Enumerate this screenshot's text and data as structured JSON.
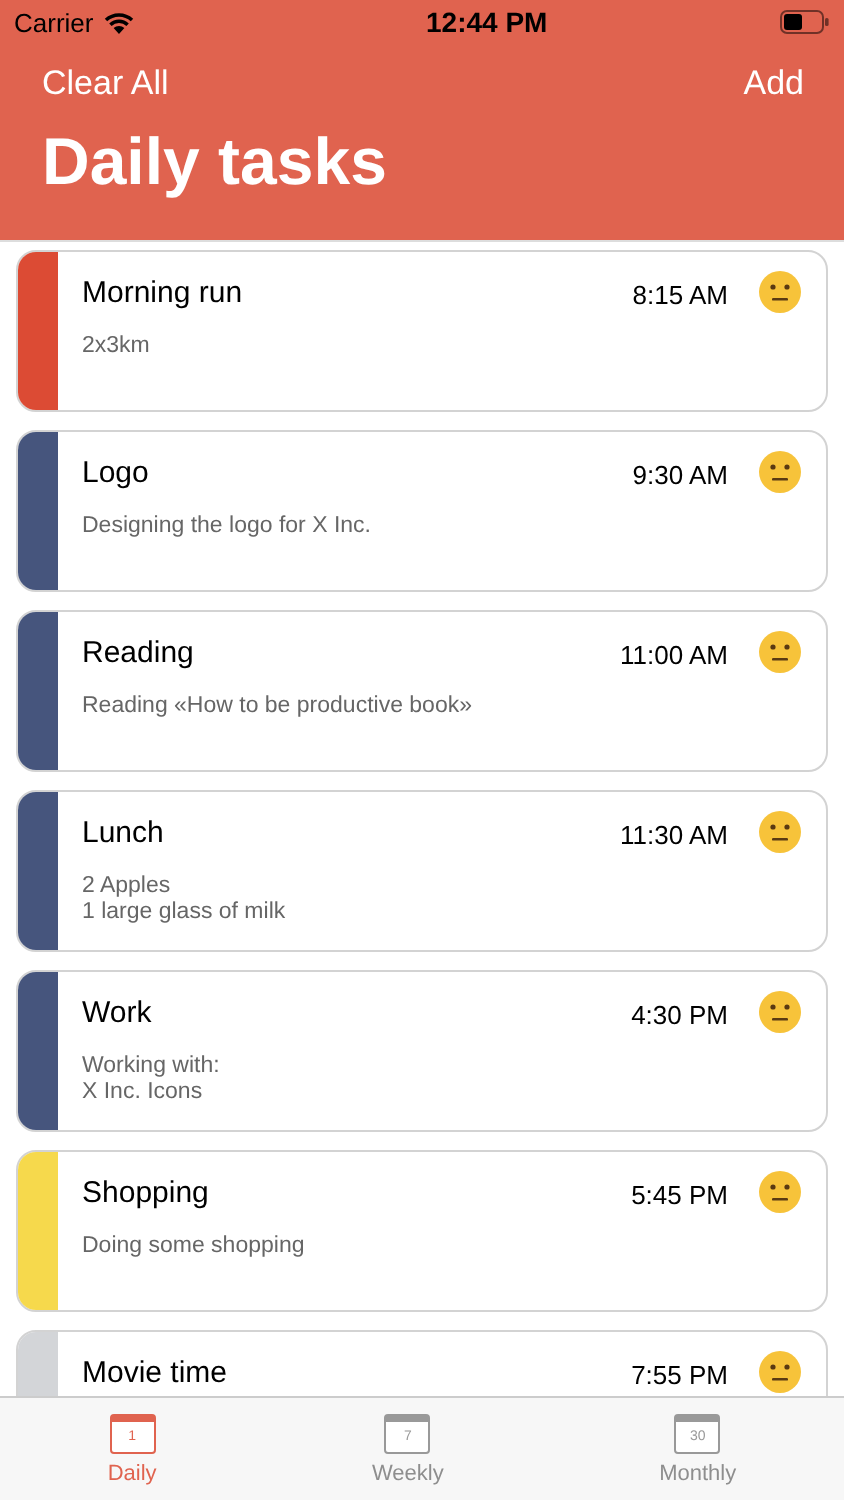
{
  "status_bar": {
    "carrier": "Carrier",
    "time": "12:44 PM"
  },
  "nav": {
    "left": "Clear All",
    "right": "Add",
    "title": "Daily tasks"
  },
  "tasks": [
    {
      "title": "Morning run",
      "time": "8:15 AM",
      "color": "#dc4b34",
      "notes": [
        "2x3km"
      ]
    },
    {
      "title": "Logo",
      "time": "9:30 AM",
      "color": "#46557d",
      "notes": [
        "Designing the logo for X Inc."
      ]
    },
    {
      "title": "Reading",
      "time": "11:00 AM",
      "color": "#46557d",
      "notes": [
        "Reading «How to be productive book»"
      ]
    },
    {
      "title": "Lunch",
      "time": "11:30 AM",
      "color": "#46557d",
      "notes": [
        "2 Apples",
        "1 large glass of milk"
      ]
    },
    {
      "title": "Work",
      "time": "4:30 PM",
      "color": "#46557d",
      "notes": [
        "Working with:",
        "X Inc. Icons"
      ]
    },
    {
      "title": "Shopping",
      "time": "5:45 PM",
      "color": "#f6d94c",
      "notes": [
        "Doing some shopping"
      ]
    },
    {
      "title": "Movie time",
      "time": "7:55 PM",
      "color": "#d3d5d8"
    }
  ],
  "tab_bar": [
    {
      "label": "Daily",
      "day": "1",
      "selected": true
    },
    {
      "label": "Weekly",
      "day": "7",
      "selected": false
    },
    {
      "label": "Monthly",
      "day": "30",
      "selected": false
    }
  ]
}
